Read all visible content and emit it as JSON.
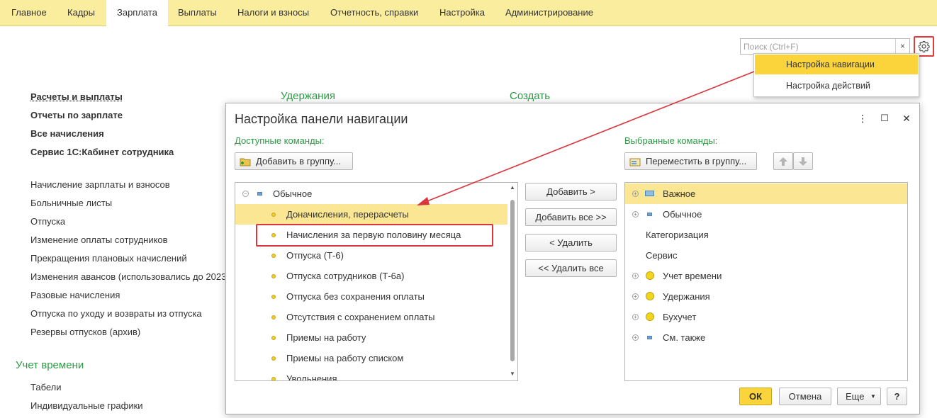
{
  "menu": {
    "tabs": [
      {
        "label": "Главное"
      },
      {
        "label": "Кадры"
      },
      {
        "label": "Зарплата"
      },
      {
        "label": "Выплаты"
      },
      {
        "label": "Налоги и взносы"
      },
      {
        "label": "Отчетность, справки"
      },
      {
        "label": "Настройка"
      },
      {
        "label": "Администрирование"
      }
    ],
    "active_tab": "Зарплата"
  },
  "search": {
    "placeholder": "Поиск (Ctrl+F)",
    "clear_label": "×"
  },
  "gear_menu": {
    "items": [
      {
        "label": "Настройка навигации"
      },
      {
        "label": "Настройка действий"
      }
    ]
  },
  "panel": {
    "main_links": [
      {
        "label": "Расчеты и выплаты"
      },
      {
        "label": "Отчеты по зарплате"
      },
      {
        "label": "Все начисления"
      },
      {
        "label": "Сервис 1С:Кабинет сотрудника"
      }
    ],
    "links": [
      {
        "label": "Начисление зарплаты и взносов"
      },
      {
        "label": "Больничные листы"
      },
      {
        "label": "Отпуска"
      },
      {
        "label": "Изменение оплаты сотрудников"
      },
      {
        "label": "Прекращения плановых начислений"
      },
      {
        "label": "Изменения авансов (использовались до 2023"
      },
      {
        "label": "Разовые начисления"
      },
      {
        "label": "Отпуска по уходу и возвраты из отпуска"
      },
      {
        "label": "Резервы отпусков (архив)"
      }
    ],
    "section_time": "Учет времени",
    "time_links": [
      {
        "label": "Табели"
      },
      {
        "label": "Индивидуальные графики"
      }
    ],
    "section_deductions": "Удержания",
    "section_create": "Создать"
  },
  "dialog": {
    "title": "Настройка панели навигации",
    "controls": {
      "more": "⋮",
      "maximize": "☐",
      "close": "✕"
    },
    "available_label": "Доступные команды:",
    "selected_label": "Выбранные команды:",
    "add_to_group_button": "Добавить в группу...",
    "move_to_group_button": "Переместить в группу...",
    "available_group": "Обычное",
    "available_items": [
      {
        "label": "Доначисления, перерасчеты"
      },
      {
        "label": "Начисления за первую половину месяца"
      },
      {
        "label": "Отпуска (Т-6)"
      },
      {
        "label": "Отпуска сотрудников (Т-6а)"
      },
      {
        "label": "Отпуска без сохранения оплаты"
      },
      {
        "label": "Отсутствия с сохранением оплаты"
      },
      {
        "label": "Приемы на работу"
      },
      {
        "label": "Приемы на работу списком"
      },
      {
        "label": "Увольнения"
      }
    ],
    "middle_buttons": {
      "add": "Добавить >",
      "add_all": "Добавить все >>",
      "remove": "< Удалить",
      "remove_all": "<< Удалить все"
    },
    "selected_items": [
      {
        "label": "Важное"
      },
      {
        "label": "Обычное"
      },
      {
        "label": "Категоризация"
      },
      {
        "label": "Сервис"
      },
      {
        "label": "Учет времени"
      },
      {
        "label": "Удержания"
      },
      {
        "label": "Бухучет"
      },
      {
        "label": "См. также"
      }
    ],
    "footer": {
      "ok": "ОК",
      "cancel": "Отмена",
      "more": "Еще",
      "help": "?"
    }
  },
  "colors": {
    "menu_bg": "#fbed9e",
    "accent": "#fbd43b",
    "section_green": "#2d9a44",
    "highlight_row": "#fbe793",
    "annotation_red": "#d9363e"
  }
}
